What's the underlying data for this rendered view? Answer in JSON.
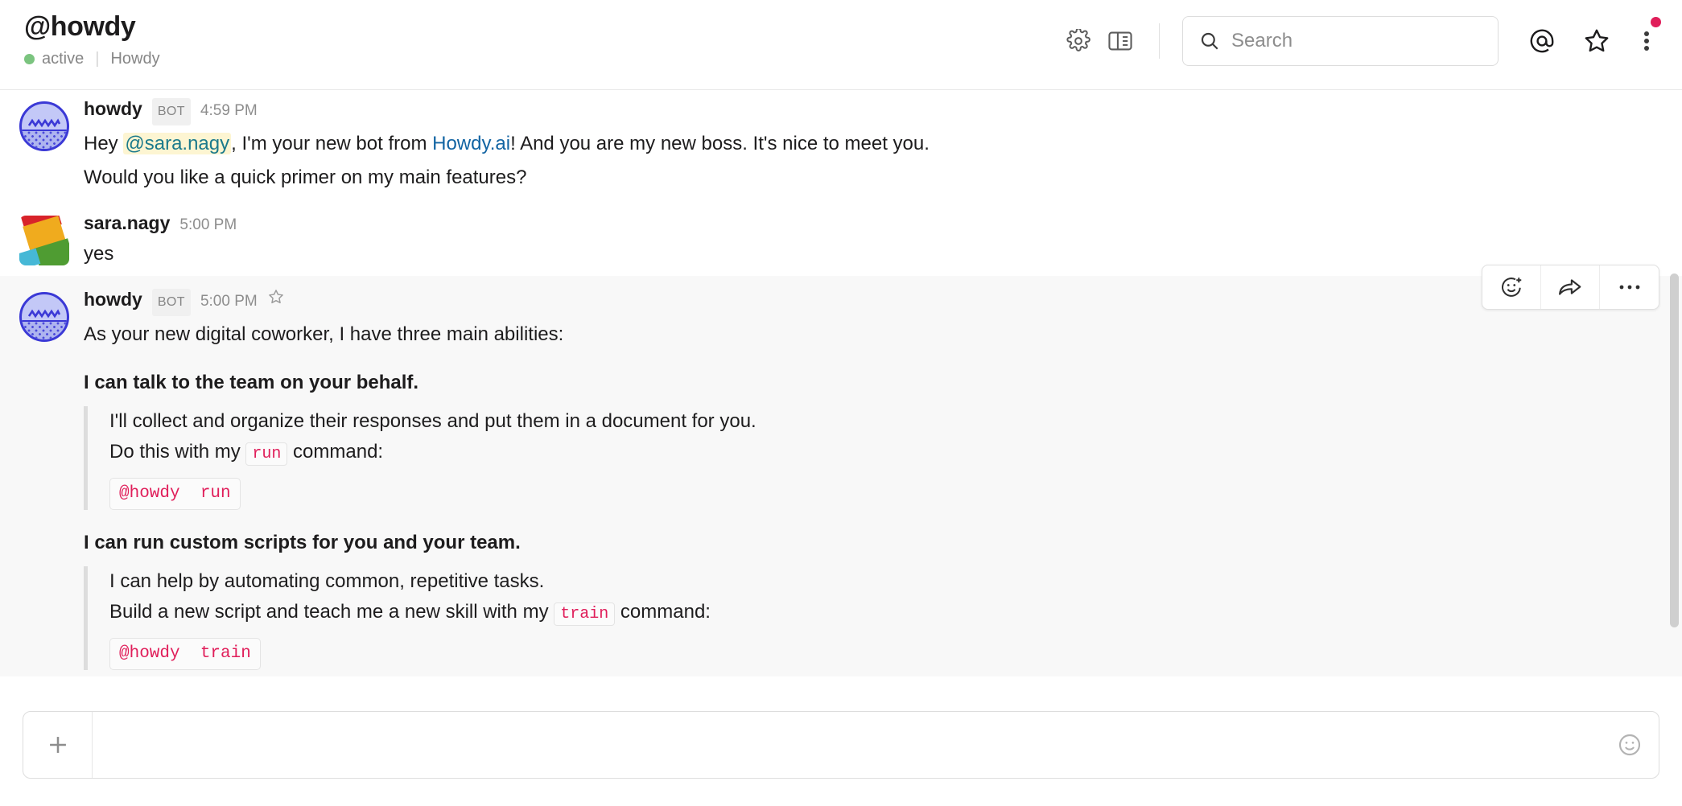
{
  "header": {
    "channel_title": "@howdy",
    "presence": "active",
    "app_name": "Howdy",
    "icons": {
      "settings": "gear-icon",
      "panel": "split-view-icon",
      "search": "search-icon",
      "mentions": "at-mentions-icon",
      "saved": "star-icon",
      "more": "kebab-menu-icon"
    },
    "search_placeholder": "Search",
    "notification_badge": true,
    "accent_color": "#e01e5a",
    "presence_color": "#7bc47f"
  },
  "messages": [
    {
      "author": "howdy",
      "badge": "BOT",
      "timestamp": "4:59 PM",
      "avatar": "howdy-bot-avatar",
      "lines": [
        {
          "type": "rich",
          "pre": "Hey ",
          "mention": "@sara.nagy",
          "mid": ", I'm your new bot from ",
          "link": "Howdy.ai",
          "post": "! And you are my new boss. It's nice to meet you."
        },
        {
          "type": "text",
          "text": "Would you like a quick primer on my main features?"
        }
      ]
    },
    {
      "author": "sara.nagy",
      "badge": "",
      "timestamp": "5:00 PM",
      "avatar": "sara-nagy-avatar",
      "lines": [
        {
          "type": "text",
          "text": "yes"
        }
      ]
    },
    {
      "author": "howdy",
      "badge": "BOT",
      "timestamp": "5:00 PM",
      "avatar": "howdy-bot-avatar",
      "hovered": true,
      "intro": "As your new digital coworker, I have three main abilities:",
      "sections": [
        {
          "heading": "I can talk to the team on your behalf.",
          "body_line_1": "I'll collect and organize their responses and put them in a document for you.",
          "body_line_2_pre": "Do this with my ",
          "body_line_2_code": "run",
          "body_line_2_post": " command:",
          "codeblock": "@howdy  run"
        },
        {
          "heading": "I can run custom scripts for you and your team.",
          "body_line_1": "I can help by automating common, repetitive tasks.",
          "body_line_2_pre": "Build a new script and teach me a new skill with my ",
          "body_line_2_code": "train",
          "body_line_2_post": " command:",
          "codeblock": "@howdy  train"
        }
      ]
    }
  ],
  "hover_toolbar": {
    "add_reaction": "add-reaction-icon",
    "forward": "forward-icon",
    "more": "more-actions-icon"
  },
  "composer": {
    "add_label": "+",
    "placeholder": "",
    "value": "",
    "emoji": "emoji-icon"
  }
}
